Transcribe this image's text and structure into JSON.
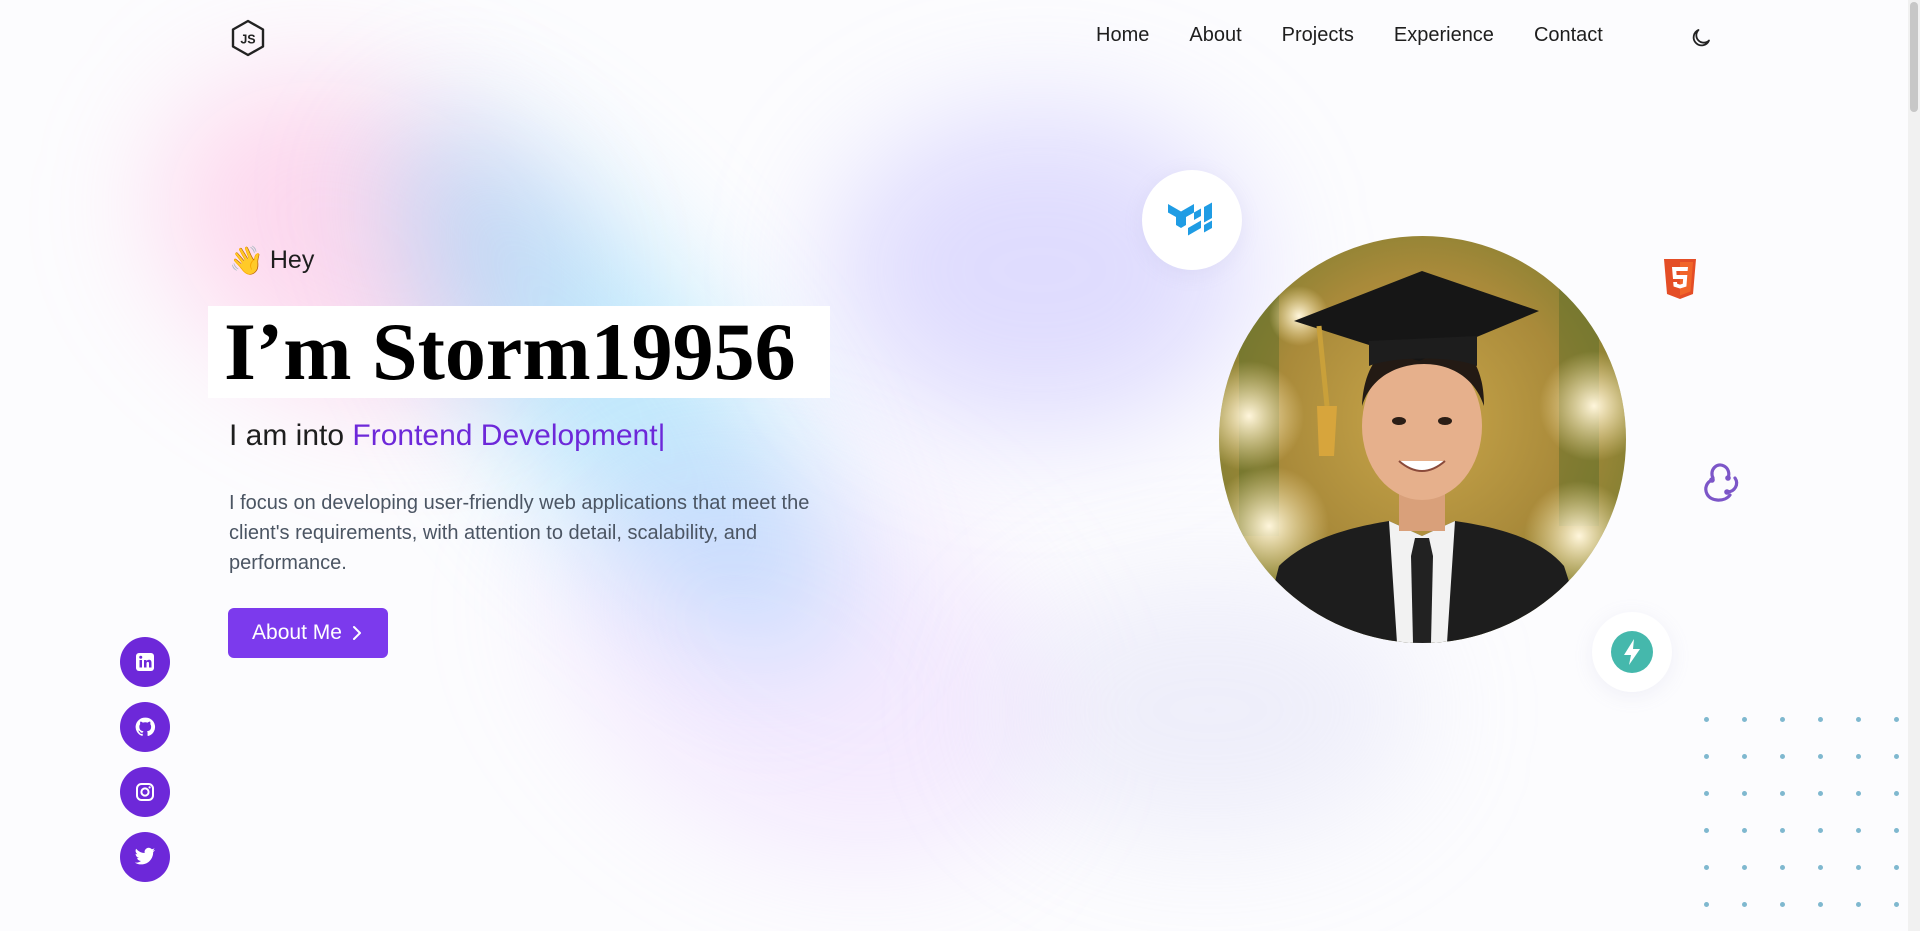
{
  "header": {
    "nav": [
      {
        "label": "Home"
      },
      {
        "label": "About"
      },
      {
        "label": "Projects"
      },
      {
        "label": "Experience"
      },
      {
        "label": "Contact"
      }
    ]
  },
  "hero": {
    "greeting_emoji": "👋",
    "greeting": "Hey",
    "name": "I’m Storm19956",
    "role_prefix": "I am into ",
    "role_highlight": "Frontend Development",
    "role_cursor": "|",
    "description": "I focus on developing user-friendly web applications that meet the client's requirements, with attention to detail, scalability, and performance.",
    "cta_label": "About Me",
    "cta_icon": "chevron-right-icon"
  },
  "social": [
    {
      "icon": "linkedin-icon"
    },
    {
      "icon": "github-icon"
    },
    {
      "icon": "instagram-icon"
    },
    {
      "icon": "twitter-icon"
    }
  ],
  "tech_icons": [
    "mui-icon",
    "html5-icon",
    "redux-icon",
    "bolt-icon"
  ],
  "colors": {
    "accent": "#7c3aed",
    "accent_dark": "#6d28d9",
    "text": "#1e1e1e",
    "muted": "#4b5563"
  }
}
